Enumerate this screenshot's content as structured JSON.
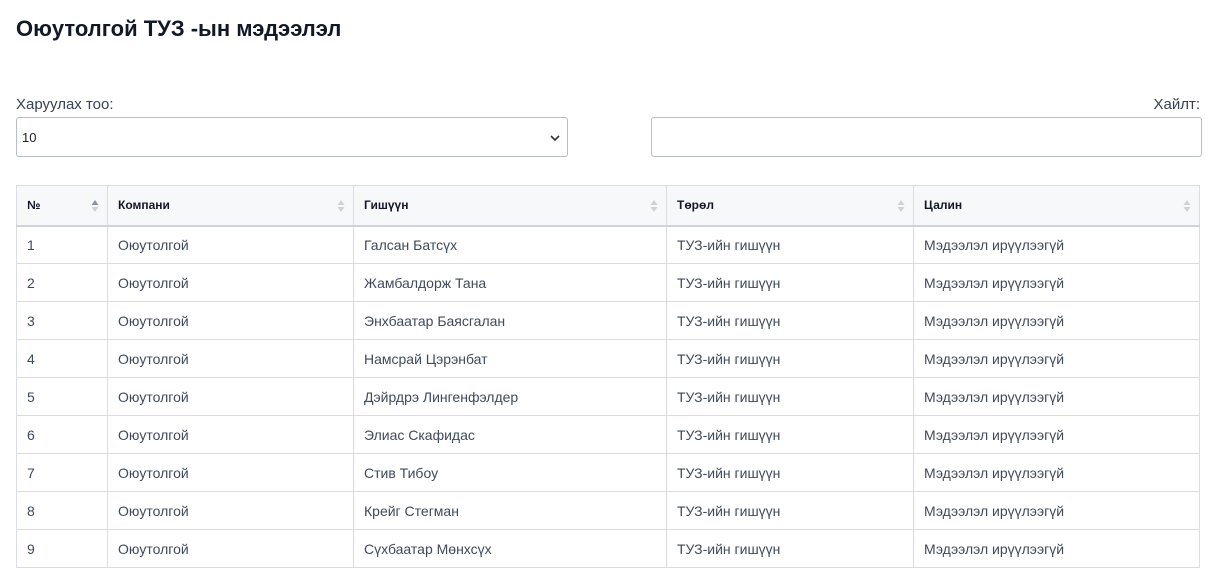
{
  "page": {
    "title": "Оюутолгой ТУЗ -ын мэдээлэл"
  },
  "controls": {
    "length_label": "Харуулах тоо:",
    "length_value": "10",
    "search_label": "Хайлт:",
    "search_value": ""
  },
  "table": {
    "headers": [
      "№",
      "Компани",
      "Гишүүн",
      "Төрөл",
      "Цалин"
    ],
    "rows": [
      [
        "1",
        "Оюутолгой",
        "Галсан Батсүх",
        "ТУЗ-ийн гишүүн",
        "Мэдээлэл ирүүлээгүй"
      ],
      [
        "2",
        "Оюутолгой",
        "Жамбалдорж Тана",
        "ТУЗ-ийн гишүүн",
        "Мэдээлэл ирүүлээгүй"
      ],
      [
        "3",
        "Оюутолгой",
        "Энхбаатар Баясгалан",
        "ТУЗ-ийн гишүүн",
        "Мэдээлэл ирүүлээгүй"
      ],
      [
        "4",
        "Оюутолгой",
        "Намсрай Цэрэнбат",
        "ТУЗ-ийн гишүүн",
        "Мэдээлэл ирүүлээгүй"
      ],
      [
        "5",
        "Оюутолгой",
        "Дэйрдрэ Лингенфэлдер",
        "ТУЗ-ийн гишүүн",
        "Мэдээлэл ирүүлээгүй"
      ],
      [
        "6",
        "Оюутолгой",
        "Элиас Скафидас",
        "ТУЗ-ийн гишүүн",
        "Мэдээлэл ирүүлээгүй"
      ],
      [
        "7",
        "Оюутолгой",
        "Стив Тибоу",
        "ТУЗ-ийн гишүүн",
        "Мэдээлэл ирүүлээгүй"
      ],
      [
        "8",
        "Оюутолгой",
        "Крейг Стегман",
        "ТУЗ-ийн гишүүн",
        "Мэдээлэл ирүүлээгүй"
      ],
      [
        "9",
        "Оюутолгой",
        "Сүхбаатар Мөнхсүх",
        "ТУЗ-ийн гишүүн",
        "Мэдээлэл ирүүлээгүй"
      ]
    ]
  },
  "icons": {
    "select": "chevron-down-icon",
    "sort": "sort-icon",
    "sort_active_column": 0
  }
}
